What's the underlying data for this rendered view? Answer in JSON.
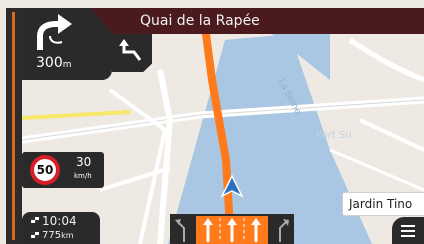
{
  "header": {
    "street": "Quai de la Rapée"
  },
  "turn": {
    "distance_value": "300",
    "distance_unit": "m",
    "icon": "turn-right-keep-left-icon",
    "next_icon": "next-turn-left-icon"
  },
  "speed": {
    "limit": "50",
    "current": "30",
    "unit": "km/h"
  },
  "eta": {
    "time": "10:04",
    "distance": "775",
    "distance_unit": "km"
  },
  "map": {
    "river_label": "La Seine",
    "port_label": "Port Su",
    "poi_label": "Jardin Tino"
  },
  "lanes": {
    "icons": [
      "lane-left-icon",
      "lane-straight-icon",
      "lane-straight-icon",
      "lane-straight-icon",
      "lane-right-icon"
    ]
  },
  "menu": {
    "icon": "hamburger-menu-icon"
  },
  "colors": {
    "route": "#ff7a1a",
    "bar": "#4a1a1f",
    "panel": "#2a2a2a",
    "water": "#a8c4e0",
    "speed_ring": "#d61f26"
  }
}
